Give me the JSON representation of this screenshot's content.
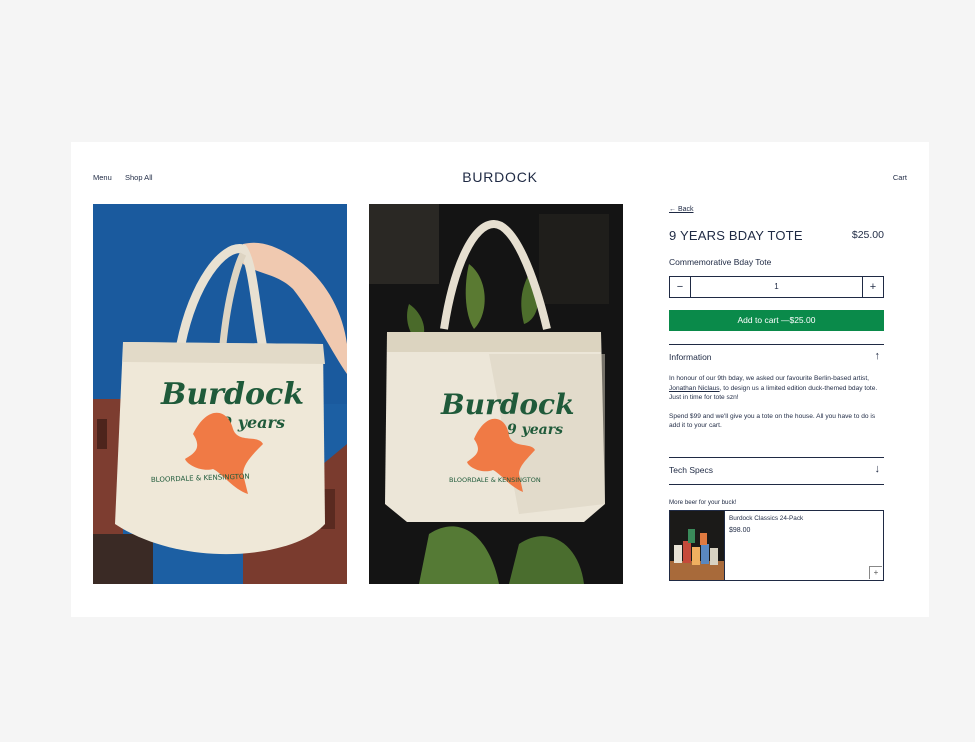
{
  "header": {
    "menu_label": "Menu",
    "shop_label": "Shop All",
    "brand": "BURDOCK",
    "cart_label": "Cart"
  },
  "gallery": {
    "photo1_icon": "tote-bag-held-against-blue-sky-photo",
    "photo2_icon": "tote-bag-hanging-over-plants-photo"
  },
  "product": {
    "back_label": "← Back",
    "title": "9 YEARS BDAY TOTE",
    "price": "$25.00",
    "subtitle": "Commemorative Bday Tote",
    "quantity": "1",
    "minus": "−",
    "plus": "+",
    "add_to_cart": "Add to cart —$25.00"
  },
  "info": {
    "label": "Information",
    "arrow": "↑",
    "para1_a": "In honour of our 9th bday, we asked our favourite Berlin-based artist, ",
    "para1_link": "Jonathan Niclaus",
    "para1_b": ", to design us a limited edition duck-themed bday tote. Just in time for tote szn!",
    "para2": "Spend $99 and we'll give you a tote on the house. All you have to do is add it to your cart."
  },
  "tech": {
    "label": "Tech Specs",
    "arrow": "↓"
  },
  "upsell": {
    "heading": "More beer for your buck!",
    "name": "Burdock Classics 24-Pack",
    "price": "$98.00",
    "add": "+"
  },
  "colors": {
    "accent_green": "#0a8a4a",
    "navy": "#1f2a44",
    "logo_green": "#1f5a3a",
    "bird_orange": "#f07a45"
  },
  "tote_art": {
    "script": "Burdock",
    "years": "9 years",
    "location": "BLOORDALE & KENSINGTON"
  }
}
